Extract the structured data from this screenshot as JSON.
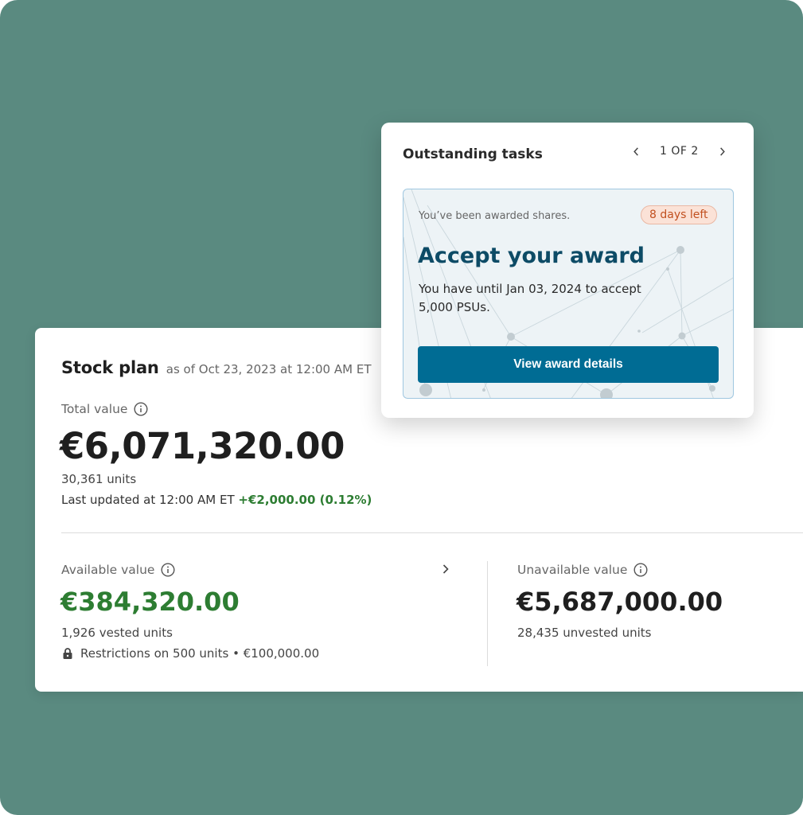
{
  "stock_plan": {
    "title": "Stock plan",
    "as_of": "as of Oct 23, 2023 at 12:00 AM ET",
    "total_value_label": "Total value",
    "total_value": "€6,071,320.00",
    "total_units": "30,361 units",
    "last_updated": "Last updated at 12:00 AM ET",
    "change": "+€2,000.00 (0.12%)",
    "available": {
      "label": "Available value",
      "value": "€384,320.00",
      "units": "1,926 vested units",
      "restrictions": "Restrictions on 500 units • €100,000.00"
    },
    "unavailable": {
      "label": "Unavailable value",
      "value": "€5,687,000.00",
      "units": "28,435 unvested units"
    }
  },
  "tasks": {
    "title": "Outstanding tasks",
    "pager": "1 OF 2",
    "award": {
      "intro": "You’ve been awarded shares.",
      "badge": "8 days left",
      "title": "Accept your award",
      "description": "You have until Jan 03, 2024 to accept 5,000 PSUs.",
      "button": "View award details"
    }
  },
  "colors": {
    "background": "#5a8a80",
    "positive": "#2d7d32",
    "primary_button": "#006c94",
    "award_title": "#0d4b66",
    "badge_text": "#c2501f"
  },
  "icons": [
    "info-icon",
    "chevron-right-icon",
    "chevron-left-icon",
    "lock-icon"
  ]
}
